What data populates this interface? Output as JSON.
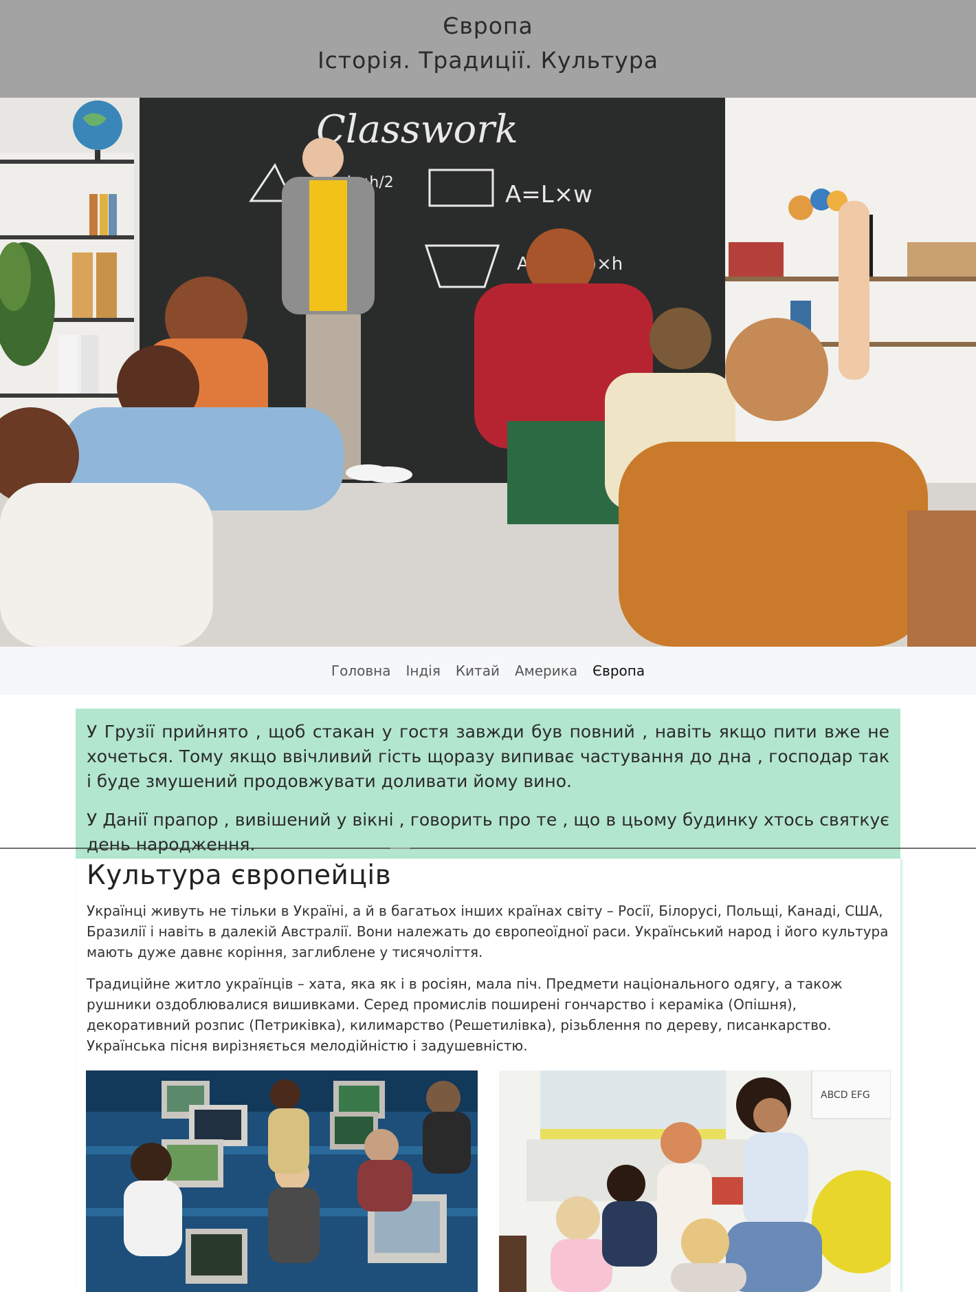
{
  "header": {
    "title": "Європа",
    "subtitle": "Історія. Традиції. Культура"
  },
  "hero": {
    "board_text": "Classwork",
    "formula_area": "A=L×w",
    "formula_trap": "A=(B+b)×h",
    "formula_tri": "b×h/2"
  },
  "nav": {
    "items": [
      {
        "label": "Головна"
      },
      {
        "label": "Індія"
      },
      {
        "label": "Китай"
      },
      {
        "label": "Америка"
      },
      {
        "label": "Європа"
      }
    ]
  },
  "facts": {
    "p1": "У Грузії прийнято , щоб стакан у гостя завжди був повний , навіть якщо пити вже не хочеться. Тому якщо ввічливий гість щоразу випиває частування до дна , господар так і буде змушений продовжувати доливати йому вино.",
    "p2": "У Данії прапор , вивішений у вікні , говорить про те , що в цьому будинку хтось святкує день народження."
  },
  "content": {
    "heading": "Культура європейців",
    "p1": "Українці живуть не тільки в Україні, а й в багатьох інших країнах світу – Росії, Білорусі, Польщі, Канаді, США, Бразилії і навіть в далекій Австралії. Вони належать до європеоїдної раси. Український народ і його культура мають дуже давнє коріння, заглиблене у тисячоліття.",
    "p2": "Традиційне житло українців – хата, яка як і в росіян, мала піч. Предмети національного одягу, а також рушники оздоблювалися вишивками. Серед промислів поширені гончарство і кераміка (Опішня), декоративний розпис (Петриківка), килимарство (Решетилівка), різьблення по дереву, писанкарство. Українська пісня вирізняється мелодійністю і задушевністю."
  },
  "photos": {
    "right_chart_text": "ABCD EFG"
  },
  "colors": {
    "header_bg": "#a3a3a3",
    "facts_bg": "#b3e6cf",
    "nav_bg": "#f6f7f9"
  }
}
